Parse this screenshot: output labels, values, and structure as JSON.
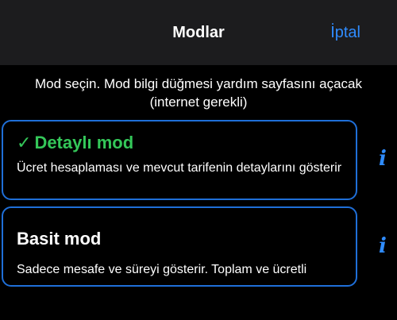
{
  "nav": {
    "title": "Modlar",
    "cancel_label": "İptal"
  },
  "instructions": "Mod seçin. Mod bilgi düğmesi yardım sayfasını açacak (internet gerekli)",
  "modes": [
    {
      "check": "✓",
      "title": "Detaylı mod",
      "description": "Ücret hesaplaması ve mevcut tarifenin detaylarını gösterir",
      "selected": true,
      "info_icon": "i"
    },
    {
      "title": "Basit mod",
      "description": "Sadece mesafe ve süreyi gösterir. Toplam ve ücretli",
      "selected": false,
      "info_icon": "i"
    }
  ],
  "colors": {
    "accent": "#2f8cff",
    "selected": "#34c759",
    "card_border": "#1f6fd8",
    "nav_background": "#1c1c1e",
    "background": "#000000"
  }
}
